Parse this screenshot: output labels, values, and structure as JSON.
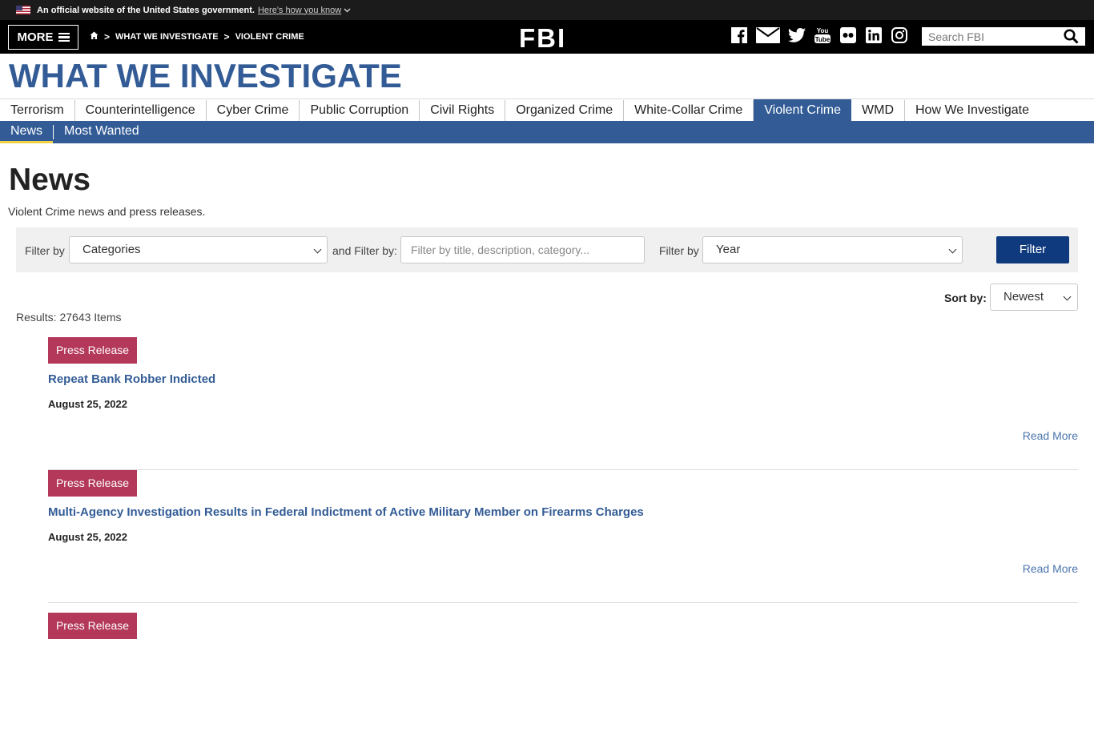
{
  "gov_banner": {
    "text": "An official website of the United States government.",
    "link": "Here's how you know"
  },
  "header": {
    "more_label": "MORE",
    "breadcrumbs": [
      "WHAT WE INVESTIGATE",
      "VIOLENT CRIME"
    ],
    "logo": "FBI",
    "search_placeholder": "Search FBI",
    "social_icons": [
      "facebook-icon",
      "email-icon",
      "twitter-icon",
      "youtube-icon",
      "flickr-icon",
      "linkedin-icon",
      "instagram-icon"
    ]
  },
  "section_title": "WHAT WE INVESTIGATE",
  "primary_nav": [
    "Terrorism",
    "Counterintelligence",
    "Cyber Crime",
    "Public Corruption",
    "Civil Rights",
    "Organized Crime",
    "White-Collar Crime",
    "Violent Crime",
    "WMD",
    "How We Investigate"
  ],
  "primary_nav_active": "Violent Crime",
  "sub_nav": [
    "News",
    "Most Wanted"
  ],
  "page": {
    "title": "News",
    "description": "Violent Crime news and press releases."
  },
  "filters": {
    "label1": "Filter by",
    "categories_value": "Categories",
    "label2": "and Filter by:",
    "text_placeholder": "Filter by title, description, category...",
    "label3": "Filter by",
    "year_value": "Year",
    "button": "Filter"
  },
  "sort": {
    "label": "Sort by:",
    "value": "Newest"
  },
  "results_text": "Results: 27643 Items",
  "news_items": [
    {
      "badge": "Press Release",
      "title": "Repeat Bank Robber Indicted",
      "date": "August 25, 2022",
      "read_more": "Read More"
    },
    {
      "badge": "Press Release",
      "title": "Multi-Agency Investigation Results in Federal Indictment of Active Military Member on Firearms Charges",
      "date": "August 25, 2022",
      "read_more": "Read More"
    },
    {
      "badge": "Press Release",
      "title": "",
      "date": "",
      "read_more": ""
    }
  ],
  "colors": {
    "brand_blue": "#335c96",
    "badge_red": "#b3385a",
    "filter_button": "#0f3a7e",
    "active_underline": "#f0d247"
  }
}
